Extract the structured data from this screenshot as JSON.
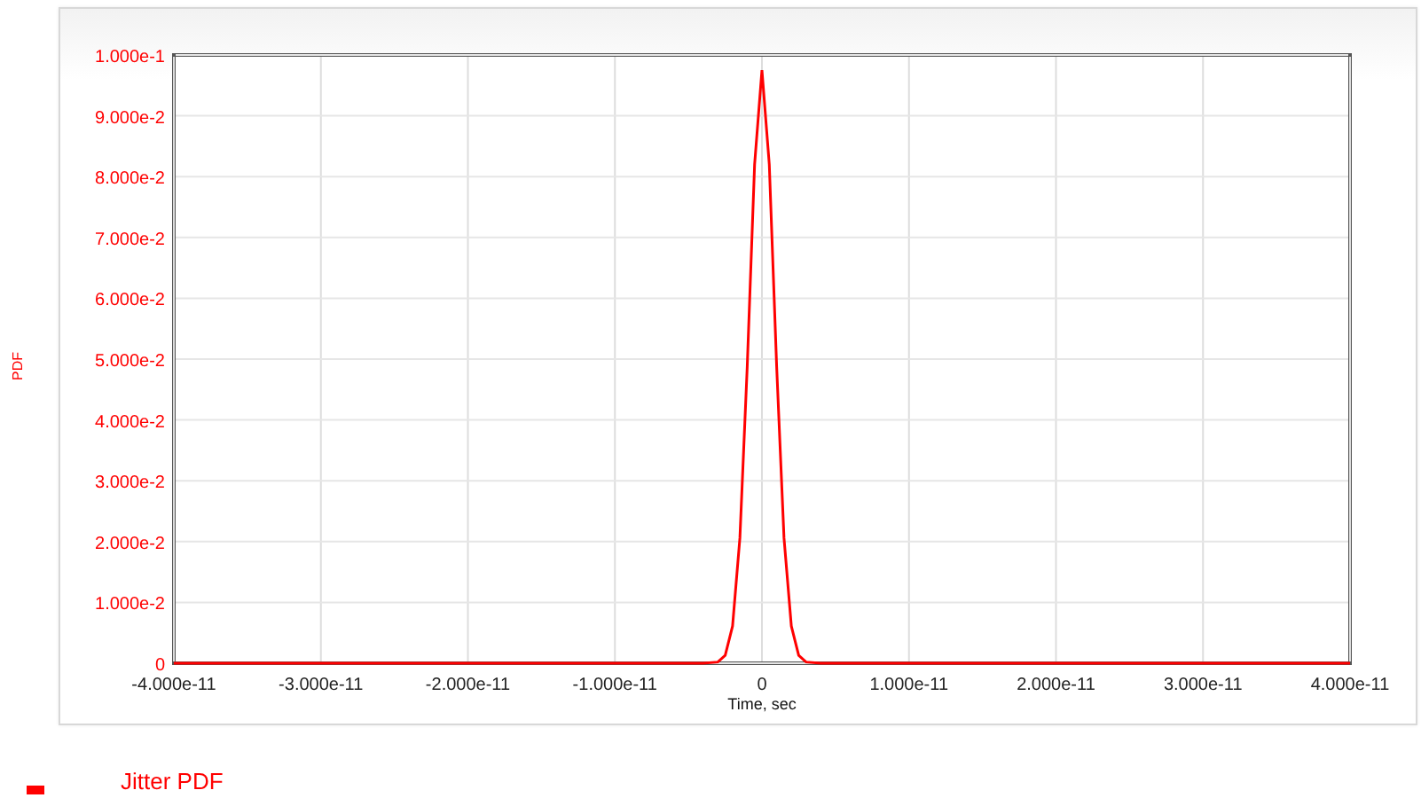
{
  "chart": {
    "chart_data": {
      "type": "line",
      "grid": true,
      "ylabel": "PDF",
      "xlabel": "Time, sec",
      "x": [
        -4e-11,
        -4e-12,
        -3e-12,
        -2.5e-12,
        -2e-12,
        -1.5e-12,
        -1e-12,
        -5e-13,
        0,
        5e-13,
        1e-12,
        1.5e-12,
        2e-12,
        2.5e-12,
        3e-12,
        4e-12,
        4e-11
      ],
      "series": [
        {
          "name": "Jitter PDF",
          "color": "#ff0000",
          "values": [
            0,
            0,
            0.0002,
            0.0013,
            0.0061,
            0.0206,
            0.0488,
            0.082,
            0.0975,
            0.082,
            0.0488,
            0.0206,
            0.0061,
            0.0013,
            0.0002,
            0,
            0
          ]
        }
      ],
      "xlim": [
        -4e-11,
        4e-11
      ],
      "ylim": [
        0,
        0.1
      ],
      "xticks": [
        {
          "value": -4e-11,
          "label": "-4.000e-11"
        },
        {
          "value": -3e-11,
          "label": "-3.000e-11"
        },
        {
          "value": -2e-11,
          "label": "-2.000e-11"
        },
        {
          "value": -1e-11,
          "label": "-1.000e-11"
        },
        {
          "value": 0,
          "label": "0"
        },
        {
          "value": 1e-11,
          "label": "1.000e-11"
        },
        {
          "value": 2e-11,
          "label": "2.000e-11"
        },
        {
          "value": 3e-11,
          "label": "3.000e-11"
        },
        {
          "value": 4e-11,
          "label": "4.000e-11"
        }
      ],
      "yticks": [
        {
          "value": 0,
          "label": "0"
        },
        {
          "value": 0.01,
          "label": "1.000e-2"
        },
        {
          "value": 0.02,
          "label": "2.000e-2"
        },
        {
          "value": 0.03,
          "label": "3.000e-2"
        },
        {
          "value": 0.04,
          "label": "4.000e-2"
        },
        {
          "value": 0.05,
          "label": "5.000e-2"
        },
        {
          "value": 0.06,
          "label": "6.000e-2"
        },
        {
          "value": 0.07,
          "label": "7.000e-2"
        },
        {
          "value": 0.08,
          "label": "8.000e-2"
        },
        {
          "value": 0.09,
          "label": "9.000e-2"
        },
        {
          "value": 0.1,
          "label": "1.000e-1"
        }
      ]
    }
  }
}
